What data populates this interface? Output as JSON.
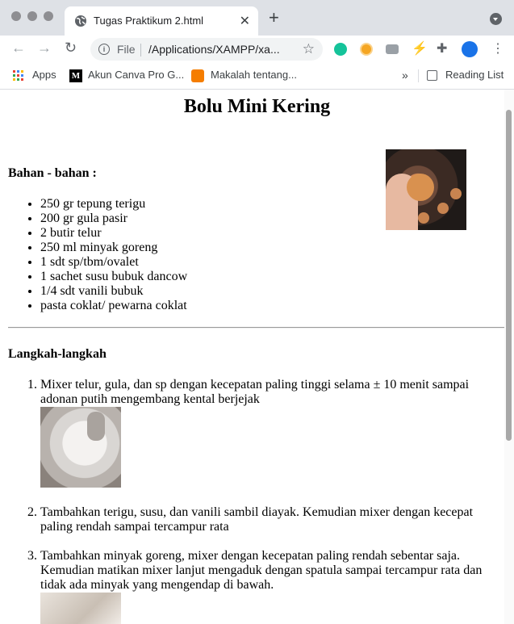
{
  "tab": {
    "title": "Tugas Praktikum 2.html"
  },
  "address": {
    "scheme_label": "File",
    "url": "/Applications/XAMPP/xa..."
  },
  "bookmarks": [
    {
      "label": "Apps"
    },
    {
      "label": "Akun Canva Pro G..."
    },
    {
      "label": "Makalah tentang..."
    }
  ],
  "reading_list": "Reading List",
  "page": {
    "title": "Bolu Mini Kering",
    "ingredients_heading": "Bahan - bahan :",
    "ingredients": [
      "250 gr tepung terigu",
      "200 gr gula pasir",
      "2 butir telur",
      "250 ml minyak goreng",
      "1 sdt sp/tbm/ovalet",
      "1 sachet susu bubuk dancow",
      "1/4 sdt vanili bubuk",
      "pasta coklat/ pewarna coklat"
    ],
    "steps_heading": "Langkah-langkah",
    "steps": [
      {
        "num": "1.",
        "lines": [
          "Mixer telur, gula, dan sp dengan kecepatan paling tinggi selama ± 10 menit sampai",
          "adonan putih mengembang kental berjejak"
        ]
      },
      {
        "num": "2.",
        "lines": [
          "Tambahkan terigu, susu, dan vanili sambil diayak. Kemudian mixer dengan kecepat",
          "paling rendah sampai tercampur rata"
        ]
      },
      {
        "num": "3.",
        "lines": [
          "Tambahkan minyak goreng, mixer dengan kecepatan paling rendah sebentar saja.",
          "Kemudian matikan mixer lanjut mengaduk dengan spatula sampai tercampur rata dan",
          "tidak ada minyak yang mengendap di bawah."
        ]
      }
    ]
  }
}
